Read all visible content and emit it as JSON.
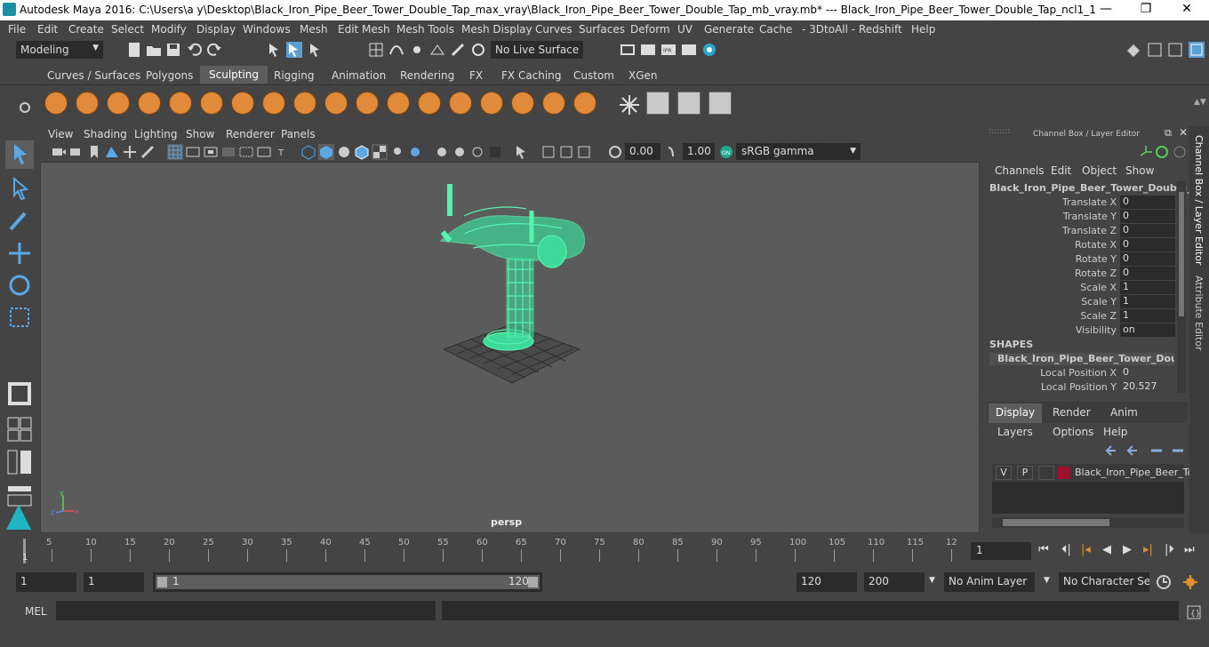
{
  "window": {
    "title": "Autodesk Maya 2016: C:\\Users\\a y\\Desktop\\Black_Iron_Pipe_Beer_Tower_Double_Tap_max_vray\\Black_Iron_Pipe_Beer_Tower_Double_Tap_mb_vray.mb*  ---  Black_Iron_Pipe_Beer_Tower_Double_Tap_ncl1_1",
    "minimize": "—",
    "maximize": "❐",
    "close": "✕"
  },
  "menubar": [
    "File",
    "Edit",
    "Create",
    "Select",
    "Modify",
    "Display",
    "Windows",
    "Mesh",
    "Edit Mesh",
    "Mesh Tools",
    "Mesh Display",
    "Curves",
    "Surfaces",
    "Deform",
    "UV",
    "Generate",
    "Cache",
    "- 3DtoAll -",
    "Redshift",
    "Help"
  ],
  "status": {
    "mode": "Modeling",
    "live_surface": "No Live Surface"
  },
  "shelf_tabs": [
    "Curves / Surfaces",
    "Polygons",
    "Sculpting",
    "Rigging",
    "Animation",
    "Rendering",
    "FX",
    "FX Caching",
    "Custom",
    "XGen"
  ],
  "active_shelf_tab": "Sculpting",
  "viewport": {
    "menus": [
      "View",
      "Shading",
      "Lighting",
      "Show",
      "Renderer",
      "Panels"
    ],
    "exposure": "0.00",
    "gamma": "1.00",
    "color_space": "sRGB gamma",
    "camera_label": "persp",
    "wire_color": "#58f2b0"
  },
  "channel_box": {
    "title": "Channel Box / Layer Editor",
    "menus": [
      "Channels",
      "Edit",
      "Object",
      "Show"
    ],
    "object_name": "Black_Iron_Pipe_Beer_Tower_Double_T...",
    "channels": [
      {
        "label": "Translate X",
        "value": "0"
      },
      {
        "label": "Translate Y",
        "value": "0"
      },
      {
        "label": "Translate Z",
        "value": "0"
      },
      {
        "label": "Rotate X",
        "value": "0"
      },
      {
        "label": "Rotate Y",
        "value": "0"
      },
      {
        "label": "Rotate Z",
        "value": "0"
      },
      {
        "label": "Scale X",
        "value": "1"
      },
      {
        "label": "Scale Y",
        "value": "1"
      },
      {
        "label": "Scale Z",
        "value": "1"
      },
      {
        "label": "Visibility",
        "value": "on"
      }
    ],
    "shapes_header": "SHAPES",
    "shape_name": "Black_Iron_Pipe_Beer_Tower_Double...",
    "shape_channels": [
      {
        "label": "Local Position X",
        "value": "0"
      },
      {
        "label": "Local Position Y",
        "value": "20.527"
      }
    ]
  },
  "layer_editor": {
    "tabs": [
      "Display",
      "Render",
      "Anim"
    ],
    "active_tab": "Display",
    "menus": [
      "Layers",
      "Options",
      "Help"
    ],
    "layer": {
      "v": "V",
      "p": "P",
      "name": "Black_Iron_Pipe_Beer_Tov",
      "color": "#a0102a"
    }
  },
  "side_tabs": [
    "Channel Box / Layer Editor",
    "Attribute Editor"
  ],
  "timeline": {
    "ticks": [
      "5",
      "10",
      "15",
      "20",
      "25",
      "30",
      "35",
      "40",
      "45",
      "50",
      "55",
      "60",
      "65",
      "70",
      "75",
      "80",
      "85",
      "90",
      "95",
      "100",
      "105",
      "110",
      "115",
      "12"
    ],
    "current_frame_marker": "1",
    "current_frame": "1"
  },
  "range": {
    "start": "1",
    "playback_start": "1",
    "slider_start": "1",
    "slider_end": "120",
    "playback_end": "120",
    "end": "200",
    "anim_layer": "No Anim Layer",
    "character_set": "No Character Set"
  },
  "command": {
    "label": "MEL"
  }
}
